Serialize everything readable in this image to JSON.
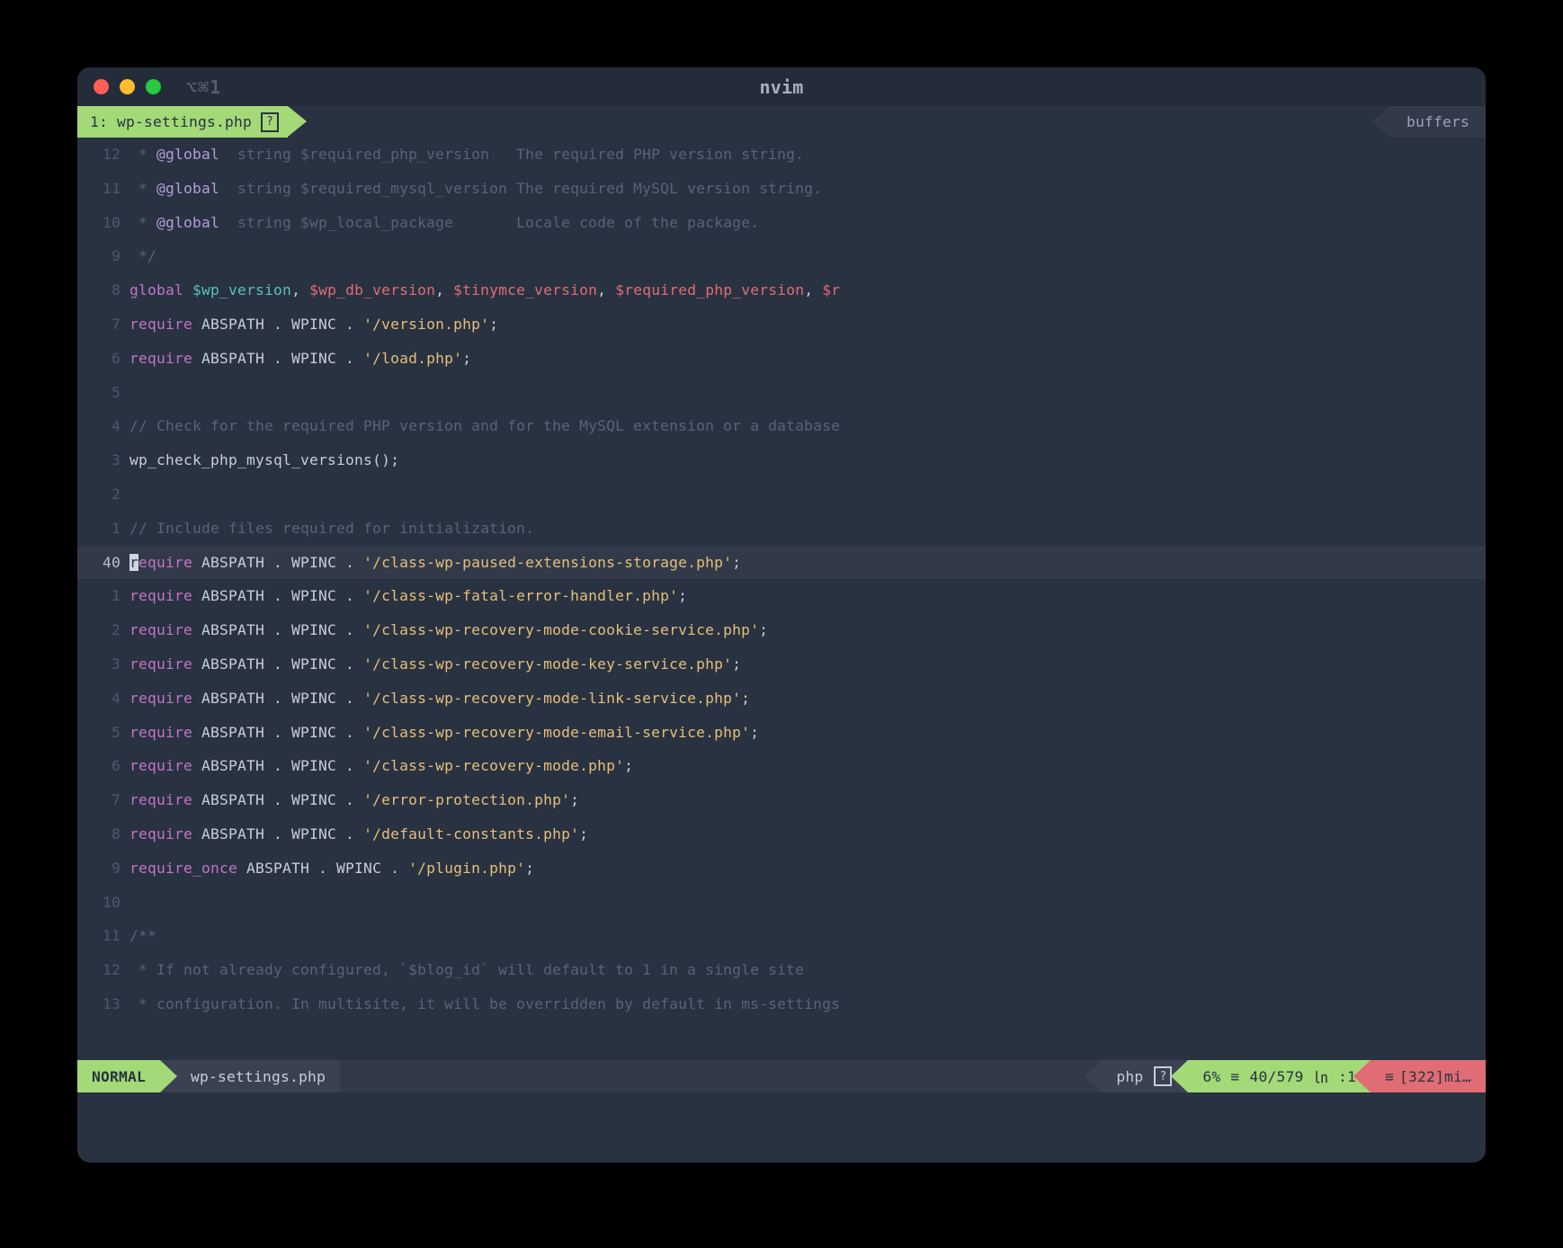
{
  "titlebar": {
    "shortcut": "⌥⌘1",
    "title": "nvim"
  },
  "tab": {
    "label": "1: wp-settings.php",
    "help": "?"
  },
  "buffers_label": "buffers",
  "lines": [
    {
      "n": "12",
      "cur": false,
      "tokens": [
        {
          "c": "comment",
          "t": " * "
        },
        {
          "c": "doc-tag",
          "t": "@global"
        },
        {
          "c": "comment",
          "t": "  string $required_php_version   The required PHP version string."
        }
      ]
    },
    {
      "n": "11",
      "cur": false,
      "tokens": [
        {
          "c": "comment",
          "t": " * "
        },
        {
          "c": "doc-tag",
          "t": "@global"
        },
        {
          "c": "comment",
          "t": "  string $required_mysql_version The required MySQL version string."
        }
      ]
    },
    {
      "n": "10",
      "cur": false,
      "tokens": [
        {
          "c": "comment",
          "t": " * "
        },
        {
          "c": "doc-tag",
          "t": "@global"
        },
        {
          "c": "comment",
          "t": "  string $wp_local_package       Locale code of the package."
        }
      ]
    },
    {
      "n": "9",
      "cur": false,
      "tokens": [
        {
          "c": "comment",
          "t": " */"
        }
      ]
    },
    {
      "n": "8",
      "cur": false,
      "tokens": [
        {
          "c": "kw",
          "t": "global"
        },
        {
          "c": "txt",
          "t": " "
        },
        {
          "c": "varteal",
          "t": "$wp_version"
        },
        {
          "c": "punct",
          "t": ", "
        },
        {
          "c": "var",
          "t": "$wp_db_version"
        },
        {
          "c": "punct",
          "t": ", "
        },
        {
          "c": "var",
          "t": "$tinymce_version"
        },
        {
          "c": "punct",
          "t": ", "
        },
        {
          "c": "var",
          "t": "$required_php_version"
        },
        {
          "c": "punct",
          "t": ", "
        },
        {
          "c": "var",
          "t": "$r"
        }
      ]
    },
    {
      "n": "7",
      "cur": false,
      "tokens": [
        {
          "c": "kw",
          "t": "require"
        },
        {
          "c": "txt",
          "t": " ABSPATH . WPINC . "
        },
        {
          "c": "str",
          "t": "'/version.php'"
        },
        {
          "c": "punct",
          "t": ";"
        }
      ]
    },
    {
      "n": "6",
      "cur": false,
      "tokens": [
        {
          "c": "kw",
          "t": "require"
        },
        {
          "c": "txt",
          "t": " ABSPATH . WPINC . "
        },
        {
          "c": "str",
          "t": "'/load.php'"
        },
        {
          "c": "punct",
          "t": ";"
        }
      ]
    },
    {
      "n": "5",
      "cur": false,
      "tokens": [
        {
          "c": "txt",
          "t": ""
        }
      ]
    },
    {
      "n": "4",
      "cur": false,
      "tokens": [
        {
          "c": "comment",
          "t": "// Check for the required PHP version and for the MySQL extension or a database"
        }
      ]
    },
    {
      "n": "3",
      "cur": false,
      "tokens": [
        {
          "c": "fn",
          "t": "wp_check_php_mysql_versions"
        },
        {
          "c": "punct",
          "t": "();"
        }
      ]
    },
    {
      "n": "2",
      "cur": false,
      "tokens": [
        {
          "c": "txt",
          "t": ""
        }
      ]
    },
    {
      "n": "1",
      "cur": false,
      "tokens": [
        {
          "c": "comment",
          "t": "// Include files required for initialization."
        }
      ]
    },
    {
      "n": "40",
      "cur": true,
      "tokens": [
        {
          "c": "cursor",
          "t": "r"
        },
        {
          "c": "kw",
          "t": "equire"
        },
        {
          "c": "txt",
          "t": " ABSPATH . WPINC . "
        },
        {
          "c": "str",
          "t": "'/class-wp-paused-extensions-storage.php'"
        },
        {
          "c": "punct",
          "t": ";"
        }
      ]
    },
    {
      "n": "1",
      "cur": false,
      "tokens": [
        {
          "c": "kw",
          "t": "require"
        },
        {
          "c": "txt",
          "t": " ABSPATH . WPINC . "
        },
        {
          "c": "str",
          "t": "'/class-wp-fatal-error-handler.php'"
        },
        {
          "c": "punct",
          "t": ";"
        }
      ]
    },
    {
      "n": "2",
      "cur": false,
      "tokens": [
        {
          "c": "kw",
          "t": "require"
        },
        {
          "c": "txt",
          "t": " ABSPATH . WPINC . "
        },
        {
          "c": "str",
          "t": "'/class-wp-recovery-mode-cookie-service.php'"
        },
        {
          "c": "punct",
          "t": ";"
        }
      ]
    },
    {
      "n": "3",
      "cur": false,
      "tokens": [
        {
          "c": "kw",
          "t": "require"
        },
        {
          "c": "txt",
          "t": " ABSPATH . WPINC . "
        },
        {
          "c": "str",
          "t": "'/class-wp-recovery-mode-key-service.php'"
        },
        {
          "c": "punct",
          "t": ";"
        }
      ]
    },
    {
      "n": "4",
      "cur": false,
      "tokens": [
        {
          "c": "kw",
          "t": "require"
        },
        {
          "c": "txt",
          "t": " ABSPATH . WPINC . "
        },
        {
          "c": "str",
          "t": "'/class-wp-recovery-mode-link-service.php'"
        },
        {
          "c": "punct",
          "t": ";"
        }
      ]
    },
    {
      "n": "5",
      "cur": false,
      "tokens": [
        {
          "c": "kw",
          "t": "require"
        },
        {
          "c": "txt",
          "t": " ABSPATH . WPINC . "
        },
        {
          "c": "str",
          "t": "'/class-wp-recovery-mode-email-service.php'"
        },
        {
          "c": "punct",
          "t": ";"
        }
      ]
    },
    {
      "n": "6",
      "cur": false,
      "tokens": [
        {
          "c": "kw",
          "t": "require"
        },
        {
          "c": "txt",
          "t": " ABSPATH . WPINC . "
        },
        {
          "c": "str",
          "t": "'/class-wp-recovery-mode.php'"
        },
        {
          "c": "punct",
          "t": ";"
        }
      ]
    },
    {
      "n": "7",
      "cur": false,
      "tokens": [
        {
          "c": "kw",
          "t": "require"
        },
        {
          "c": "txt",
          "t": " ABSPATH . WPINC . "
        },
        {
          "c": "str",
          "t": "'/error-protection.php'"
        },
        {
          "c": "punct",
          "t": ";"
        }
      ]
    },
    {
      "n": "8",
      "cur": false,
      "tokens": [
        {
          "c": "kw",
          "t": "require"
        },
        {
          "c": "txt",
          "t": " ABSPATH . WPINC . "
        },
        {
          "c": "str",
          "t": "'/default-constants.php'"
        },
        {
          "c": "punct",
          "t": ";"
        }
      ]
    },
    {
      "n": "9",
      "cur": false,
      "tokens": [
        {
          "c": "kw",
          "t": "require_once"
        },
        {
          "c": "txt",
          "t": " ABSPATH . WPINC . "
        },
        {
          "c": "str",
          "t": "'/plugin.php'"
        },
        {
          "c": "punct",
          "t": ";"
        }
      ]
    },
    {
      "n": "10",
      "cur": false,
      "tokens": [
        {
          "c": "txt",
          "t": ""
        }
      ]
    },
    {
      "n": "11",
      "cur": false,
      "tokens": [
        {
          "c": "comment",
          "t": "/**"
        }
      ]
    },
    {
      "n": "12",
      "cur": false,
      "tokens": [
        {
          "c": "comment",
          "t": " * If not already configured, `$blog_id` will default to 1 in a single site"
        }
      ]
    },
    {
      "n": "13",
      "cur": false,
      "tokens": [
        {
          "c": "comment",
          "t": " * configuration. In multisite, it will be overridden by default in ms-settings"
        }
      ]
    }
  ],
  "status": {
    "mode": "NORMAL",
    "file": "wp-settings.php",
    "filetype": "php",
    "help": "?",
    "percent": "6%",
    "line_sym": "≡",
    "linecol": "40/579",
    "col_sym": "㏑",
    "col": ":1",
    "git_sym": "≡",
    "git": "[322]mi…"
  }
}
